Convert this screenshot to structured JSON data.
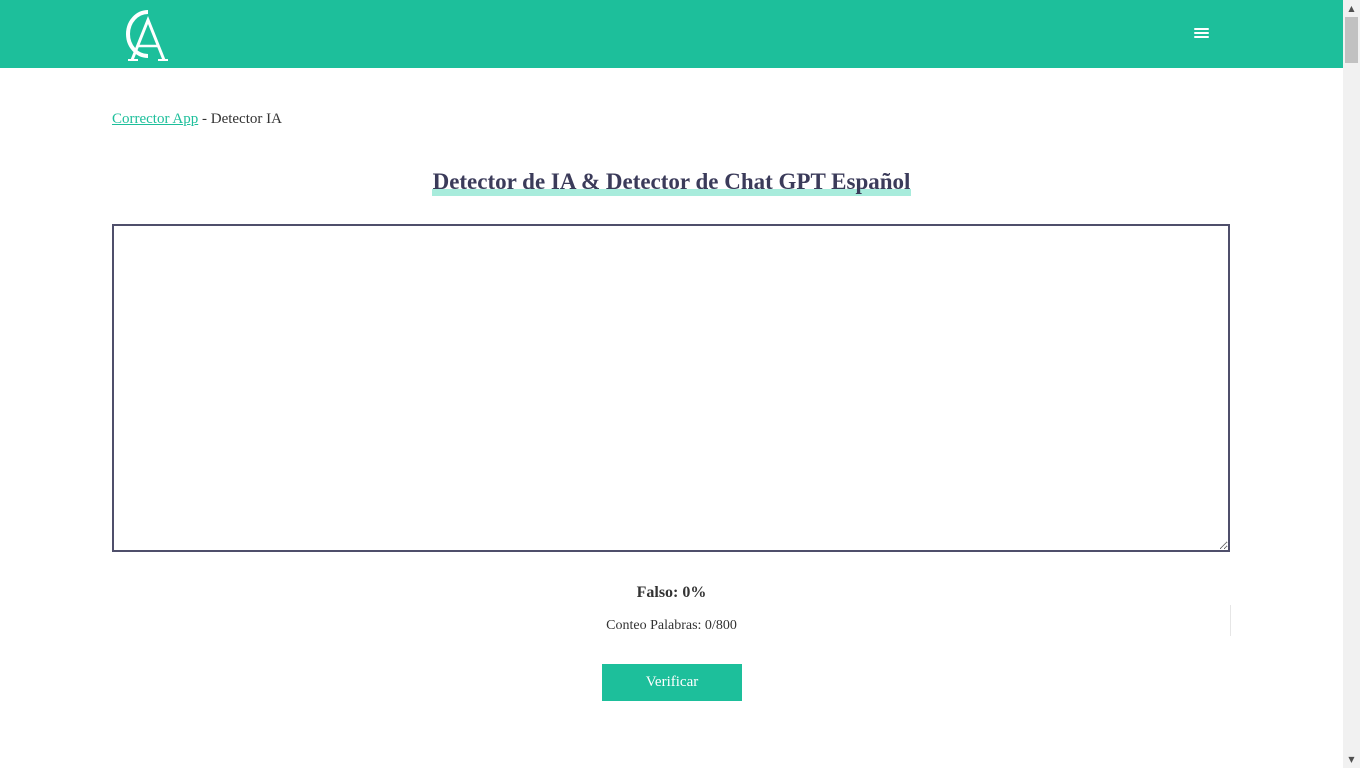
{
  "header": {
    "logo_icon": "ca-monogram-logo",
    "menu_icon": "hamburger-menu-icon",
    "background_color": "#1dbf9b"
  },
  "breadcrumb": {
    "home_link": "Corrector App",
    "separator": " - ",
    "current": "Detector IA"
  },
  "main": {
    "title": "Detector de IA & Detector de Chat GPT Español",
    "textarea_value": "",
    "result_label": "Falso: 0%",
    "word_count": "Conteo Palabras: 0/800",
    "verify_button": "Verificar"
  },
  "colors": {
    "accent": "#1dbf9b",
    "title_text": "#3b3b5a",
    "title_highlight": "#a8ecdc",
    "textarea_border": "#4f4f6b"
  }
}
